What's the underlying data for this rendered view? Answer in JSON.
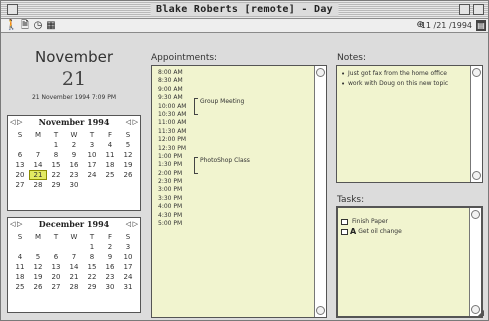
{
  "window": {
    "title": "Blake Roberts [remote] - Day"
  },
  "toolbar": {
    "tools": [
      {
        "icon": "person-icon",
        "glyph": "🚶"
      },
      {
        "icon": "document-icon",
        "glyph": "🗎"
      },
      {
        "icon": "clock-icon",
        "glyph": "◷"
      },
      {
        "icon": "calendar-icon",
        "glyph": "▦"
      }
    ],
    "date_text": "11 /21 /1994",
    "date_icon_glyph": "⊕"
  },
  "day_view": {
    "month": "November",
    "day": "21",
    "datetime": "21 November 1994 7:09 PM"
  },
  "weekday_headers": [
    "S",
    "M",
    "T",
    "W",
    "T",
    "F",
    "S"
  ],
  "mini_calendars": [
    {
      "title": "November 1994",
      "today": "21",
      "days": [
        "",
        "",
        "1",
        "2",
        "3",
        "4",
        "5",
        "6",
        "7",
        "8",
        "9",
        "10",
        "11",
        "12",
        "13",
        "14",
        "15",
        "16",
        "17",
        "18",
        "19",
        "20",
        "21",
        "22",
        "23",
        "24",
        "25",
        "26",
        "27",
        "28",
        "29",
        "30",
        "",
        "",
        ""
      ]
    },
    {
      "title": "December 1994",
      "today": "",
      "days": [
        "",
        "",
        "",
        "",
        "1",
        "2",
        "3",
        "4",
        "5",
        "6",
        "7",
        "8",
        "9",
        "10",
        "11",
        "12",
        "13",
        "14",
        "15",
        "16",
        "17",
        "18",
        "19",
        "20",
        "21",
        "22",
        "23",
        "24",
        "25",
        "26",
        "27",
        "28",
        "29",
        "30",
        "31"
      ]
    }
  ],
  "appointments": {
    "label": "Appointments:",
    "times": [
      "8:00 AM",
      "8:30 AM",
      "9:00 AM",
      "9:30 AM",
      "10:00 AM",
      "10:30 AM",
      "11:00 AM",
      "11:30 AM",
      "12:00 PM",
      "12:30 PM",
      "1:00 PM",
      "1:30 PM",
      "2:00 PM",
      "2:30 PM",
      "3:00 PM",
      "3:30 PM",
      "4:00 PM",
      "4:30 PM",
      "5:00 PM"
    ],
    "events": [
      {
        "label": "Group Meeting",
        "start": "9:30 AM",
        "end": "10:30 AM"
      },
      {
        "label": "PhotoShop Class",
        "start": "1:00 PM",
        "end": "2:00 PM"
      }
    ]
  },
  "notes": {
    "label": "Notes:",
    "items": [
      "Just got fax from the home office",
      "work with Doug on this new topic"
    ]
  },
  "tasks": {
    "label": "Tasks:",
    "items": [
      {
        "label": "Finish Paper",
        "priority": ""
      },
      {
        "label": "Get oil change",
        "priority": "A"
      }
    ]
  }
}
